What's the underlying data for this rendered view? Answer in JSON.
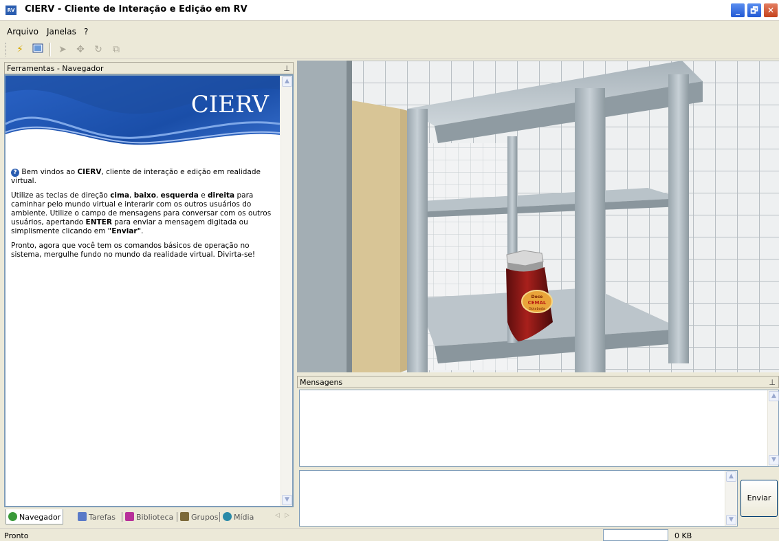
{
  "window": {
    "app_icon": "RV",
    "title": "CIERV - Cliente de Interação e Edição em RV",
    "controls": {
      "minimize": "_",
      "restore": "🗗",
      "close": "✕"
    }
  },
  "menu": [
    "Arquivo",
    "Janelas",
    "?"
  ],
  "toolbar": {
    "icons": [
      "lightning-icon",
      "window-icon",
      "pointer-icon",
      "move-icon",
      "rotate-icon",
      "scale-icon"
    ]
  },
  "left_panel": {
    "title": "Ferramentas - Navegador",
    "banner_title": "CIERV",
    "welcome": {
      "p1_a": "Bem vindos ao ",
      "p1_b": "CIERV",
      "p1_c": ", cliente de interação e edição em realidade virtual.",
      "p2_a": "Utilize as teclas de direção ",
      "p2_b": "cima",
      "p2_c": ", ",
      "p2_d": "baixo",
      "p2_e": ", ",
      "p2_f": "esquerda",
      "p2_g": " e ",
      "p2_h": "direita",
      "p2_i": " para caminhar pelo mundo virtual e interarir com os outros usuários do ambiente. Utilize o campo de mensagens para conversar com os outros usuários, apertando ",
      "p2_j": "ENTER",
      "p2_k": " para enviar a mensagem digitada ou simplismente clicando em ",
      "p2_l": "\"Enviar\"",
      "p2_m": ".",
      "p3": "Pronto, agora que você tem os comandos básicos de operação no sistema, mergulhe fundo no mundo da realidade virtual. Divirta-se!"
    },
    "tabs": [
      "Navegador",
      "Tarefas",
      "Biblioteca",
      "Grupos",
      "Mídia"
    ],
    "tab_colors": [
      "#3a9a3a",
      "#5a7ac8",
      "#b8309a",
      "#7c6a3a",
      "#2a8aa8"
    ]
  },
  "viewport": {
    "jar_label_top": "Doce",
    "jar_label_mid": "CEMAL",
    "jar_label_bot": "Goiabada"
  },
  "messages": {
    "title": "Mensagens",
    "history": "",
    "input_value": "",
    "send_label": "Enviar"
  },
  "status": {
    "text": "Pronto",
    "size": "0 KB"
  }
}
